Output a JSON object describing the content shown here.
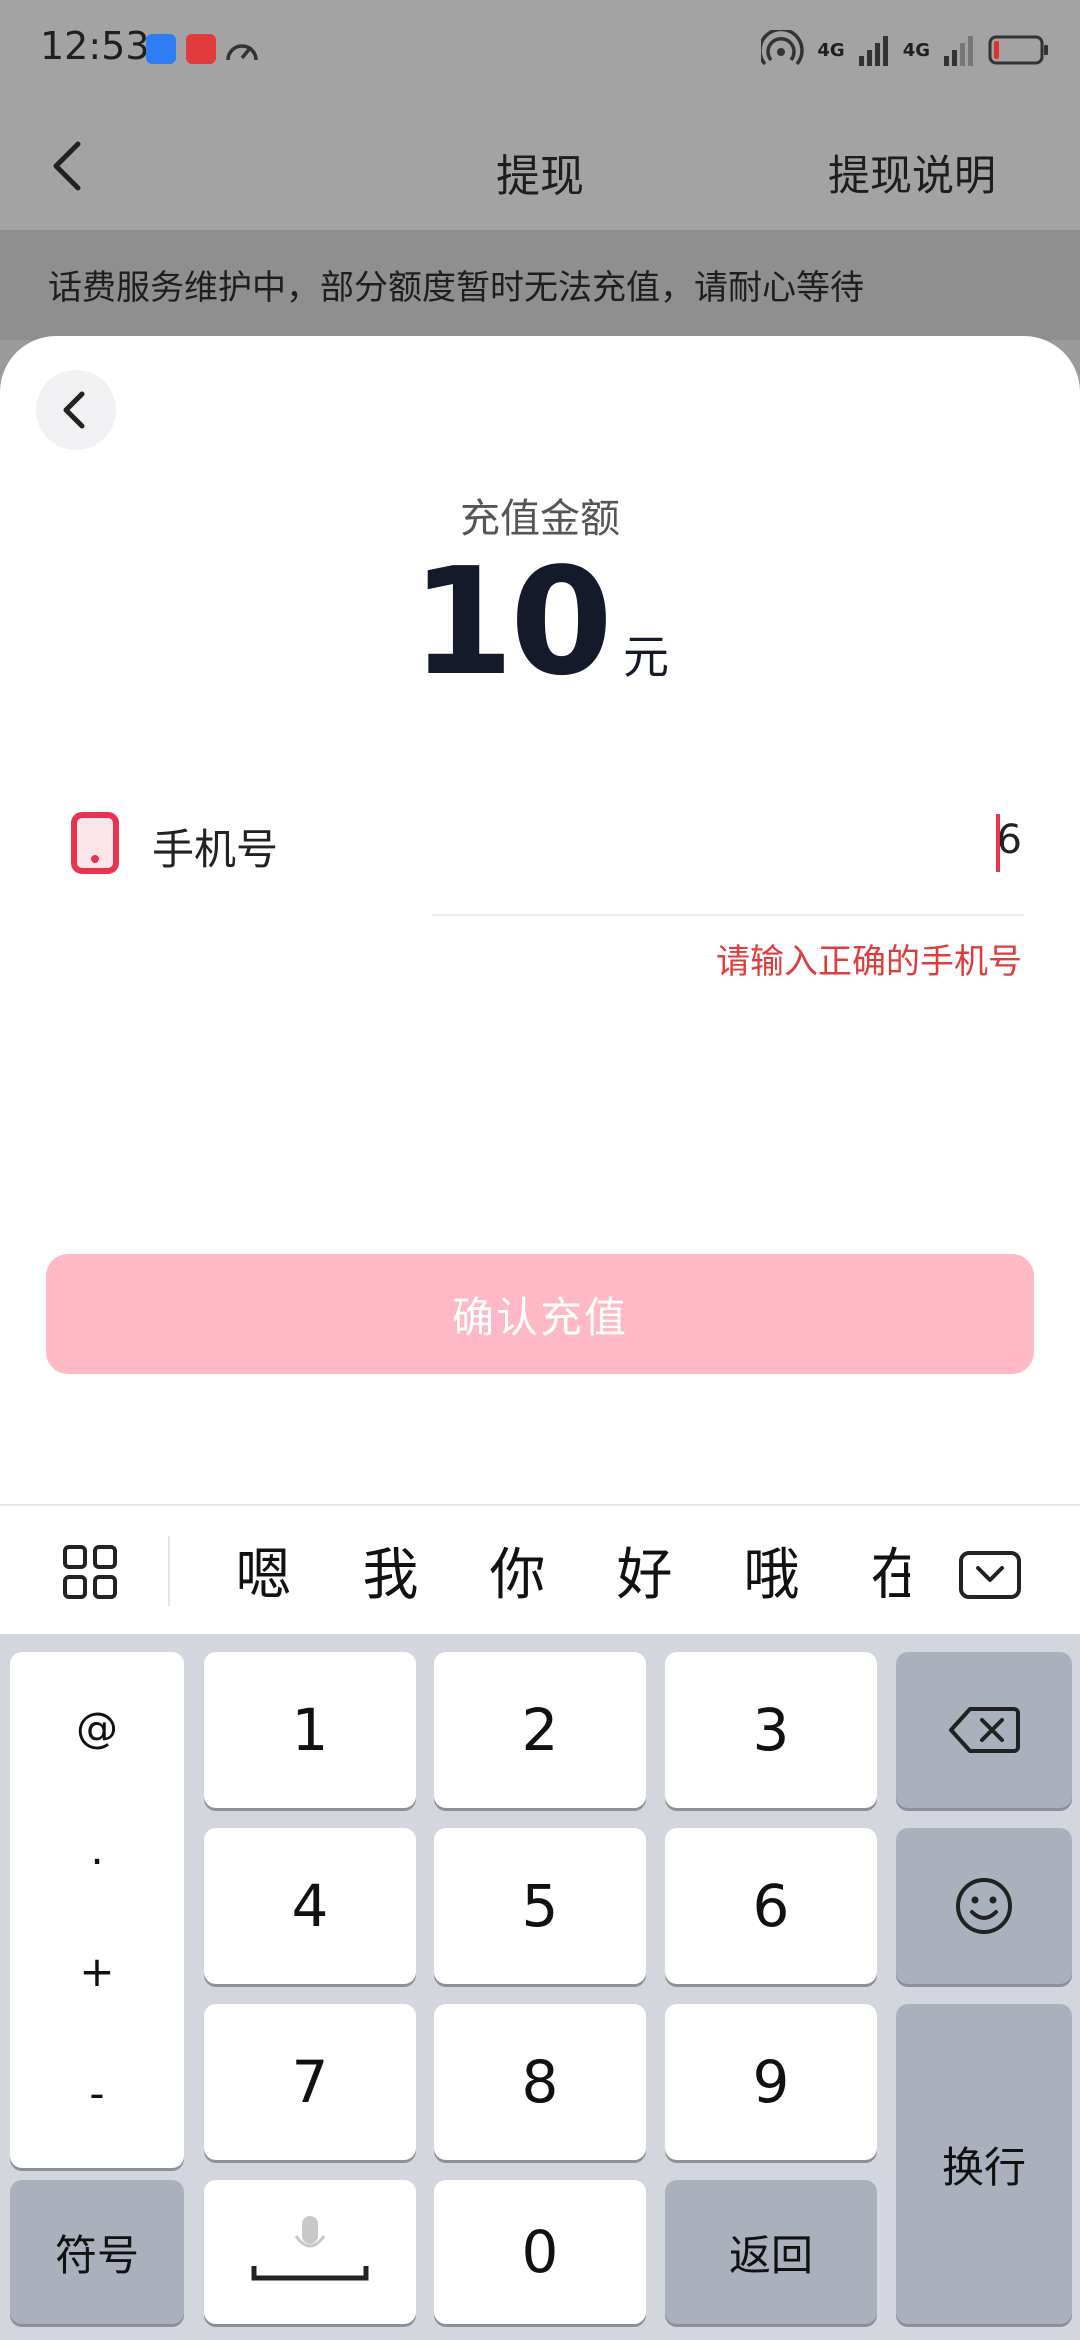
{
  "status_bar": {
    "time": "12:53",
    "network_1": "4G",
    "network_2": "4G"
  },
  "header": {
    "title": "提现",
    "help_link": "提现说明"
  },
  "notice": "话费服务维护中，部分额度暂时无法充值，请耐心等待",
  "sheet": {
    "amount_label": "充值金额",
    "amount_value": "10",
    "amount_unit": "元",
    "phone_label": "手机号",
    "phone_value": "6",
    "error_text": "请输入正确的手机号",
    "confirm_label": "确认充值"
  },
  "keyboard": {
    "candidates": [
      "嗯",
      "我",
      "你",
      "好",
      "哦",
      "在"
    ],
    "symbols": [
      "@",
      ".",
      "+",
      "-"
    ],
    "digits": [
      "1",
      "2",
      "3",
      "4",
      "5",
      "6",
      "7",
      "8",
      "9",
      "0"
    ],
    "symbol_key": "符号",
    "back_key": "返回",
    "enter_key": "换行"
  },
  "colors": {
    "accent": "#e8344e",
    "button_disabled": "#ffb8c6",
    "error": "#e03c3c"
  }
}
